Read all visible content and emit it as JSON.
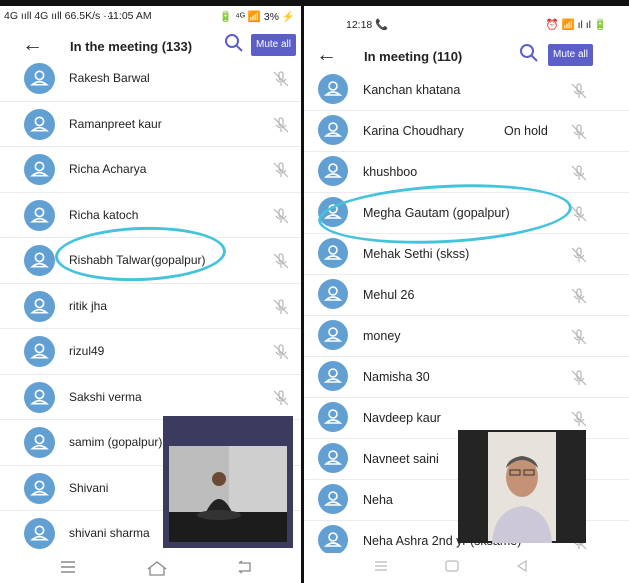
{
  "left": {
    "status_bar": {
      "left": "4G ııll 4G ııll 66.5K/s ···",
      "time": "11:05 AM",
      "right": "🔋 ⁴ᴳ 📶 3% ⚡"
    },
    "header": {
      "title": "In the meeting (133)",
      "mute_all": "Mute all"
    },
    "participants": [
      {
        "name": "Rakesh Barwal"
      },
      {
        "name": "Ramanpreet kaur"
      },
      {
        "name": "Richa Acharya"
      },
      {
        "name": "Richa katoch"
      },
      {
        "name": "Rishabh Talwar(gopalpur)"
      },
      {
        "name": "ritik jha"
      },
      {
        "name": "rizul49"
      },
      {
        "name": "Sakshi verma"
      },
      {
        "name": "samim (gopalpur)"
      },
      {
        "name": "Shivani"
      },
      {
        "name": "shivani sharma"
      }
    ]
  },
  "right": {
    "status_bar": {
      "left": "12:18 📞",
      "right": "⏰ 📶 ıl ıl 🔋"
    },
    "header": {
      "title": "In meeting (110)",
      "mute_all": "Mute all"
    },
    "participants": [
      {
        "name": "Kanchan khatana",
        "status": ""
      },
      {
        "name": "Karina Choudhary",
        "status": "On hold"
      },
      {
        "name": "khushboo",
        "status": ""
      },
      {
        "name": "Megha Gautam (gopalpur)",
        "status": ""
      },
      {
        "name": "Mehak Sethi (skss)",
        "status": ""
      },
      {
        "name": "Mehul 26",
        "status": ""
      },
      {
        "name": "money",
        "status": ""
      },
      {
        "name": "Namisha 30",
        "status": ""
      },
      {
        "name": "Navdeep kaur",
        "status": ""
      },
      {
        "name": "Navneet saini",
        "status": ""
      },
      {
        "name": "Neha",
        "status": ""
      },
      {
        "name": "Neha Ashra 2nd yr (sksame)",
        "status": ""
      }
    ]
  },
  "colors": {
    "accent": "#5b5fc7",
    "avatar": "#62a0d4",
    "highlight": "#45c3dd"
  }
}
